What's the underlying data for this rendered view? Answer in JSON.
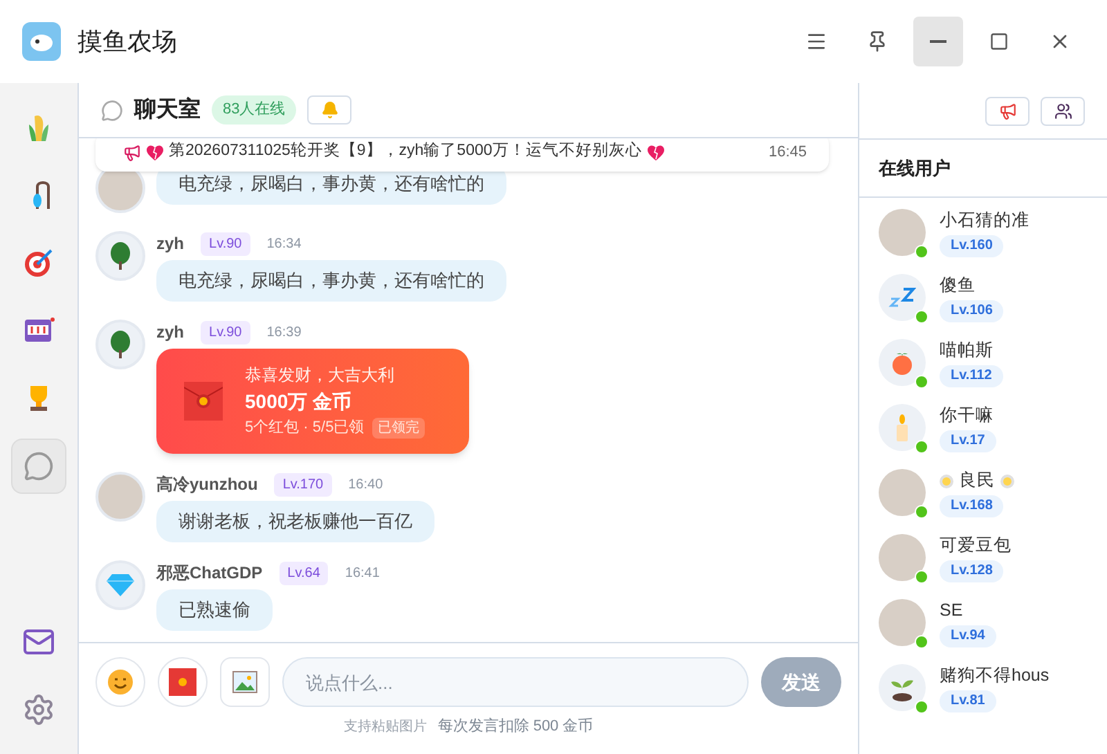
{
  "window": {
    "title": "摸鱼农场"
  },
  "nav": [
    {
      "kind": "corn",
      "selected": false
    },
    {
      "kind": "fishing",
      "selected": false
    },
    {
      "kind": "target",
      "selected": false
    },
    {
      "kind": "slot",
      "selected": false
    },
    {
      "kind": "trophy",
      "selected": false
    },
    {
      "kind": "chat",
      "selected": true
    }
  ],
  "nav_bottom": [
    {
      "kind": "mail"
    },
    {
      "kind": "settings"
    }
  ],
  "chat": {
    "title": "聊天室",
    "online_badge": "83人在线"
  },
  "toast": {
    "text": "第202607311025轮开奖【9】，zyh输了5000万！运气不好别灰心",
    "time": "16:45"
  },
  "messages": [
    {
      "kind": "text",
      "avatar": {
        "kind": "plain"
      },
      "text": "电充绿，尿喝白，事办黄，还有啥忙的"
    },
    {
      "kind": "text",
      "name": "zyh",
      "level": "Lv.90",
      "time": "16:34",
      "avatar": {
        "kind": "tree"
      },
      "text": "电充绿，尿喝白，事办黄，还有啥忙的"
    },
    {
      "kind": "packet",
      "name": "zyh",
      "level": "Lv.90",
      "time": "16:39",
      "avatar": {
        "kind": "tree"
      },
      "greeting": "恭喜发财，大吉大利",
      "amount": "5000万 金币",
      "detail": "5个红包 · 5/5已领",
      "status": "已领完"
    },
    {
      "kind": "text",
      "name": "高冷yunzhou",
      "level": "Lv.170",
      "time": "16:40",
      "avatar": {
        "kind": "plain"
      },
      "text": "谢谢老板，祝老板赚他一百亿"
    },
    {
      "kind": "text",
      "name": "邪恶ChatGDP",
      "level": "Lv.64",
      "time": "16:41",
      "avatar": {
        "kind": "diamond"
      },
      "text": "已熟速偷"
    }
  ],
  "composer": {
    "placeholder": "说点什么...",
    "send": "发送",
    "hint": "支持粘贴图片",
    "cost": "每次发言扣除 500 金币"
  },
  "online_panel": {
    "title": "在线用户",
    "users": [
      {
        "name": "小石猜的准",
        "level": "Lv.160",
        "avatar": {
          "kind": "plain"
        },
        "online": true,
        "decorated": false
      },
      {
        "name": "傻鱼",
        "level": "Lv.106",
        "avatar": {
          "kind": "sleep"
        },
        "online": true,
        "decorated": false
      },
      {
        "name": "喵帕斯",
        "level": "Lv.112",
        "avatar": {
          "kind": "peach"
        },
        "online": true,
        "decorated": false
      },
      {
        "name": "你干嘛",
        "level": "Lv.17",
        "avatar": {
          "kind": "candle"
        },
        "online": true,
        "decorated": false
      },
      {
        "name": "良民",
        "level": "Lv.168",
        "avatar": {
          "kind": "plain"
        },
        "online": true,
        "decorated": true
      },
      {
        "name": "可爱豆包",
        "level": "Lv.128",
        "avatar": {
          "kind": "plain"
        },
        "online": true,
        "decorated": false
      },
      {
        "name": "SE",
        "level": "Lv.94",
        "avatar": {
          "kind": "plain"
        },
        "online": true,
        "decorated": false
      },
      {
        "name": "赌狗不得hous",
        "level": "Lv.81",
        "avatar": {
          "kind": "sprout"
        },
        "online": true,
        "decorated": false
      }
    ]
  }
}
